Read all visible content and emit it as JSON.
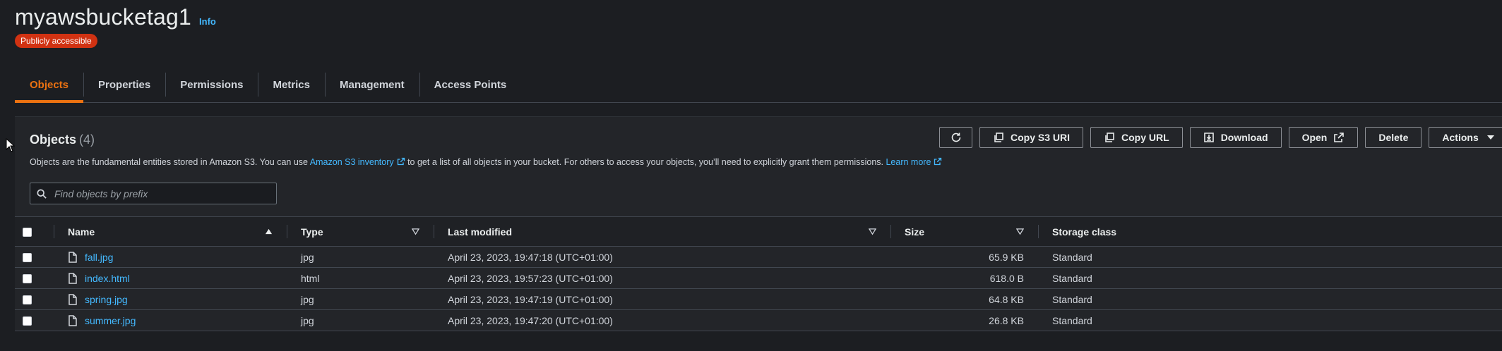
{
  "bucket": {
    "name": "myawsbucketag1",
    "info_label": "Info",
    "access_badge": "Publicly accessible"
  },
  "tabs": [
    {
      "label": "Objects",
      "active": true
    },
    {
      "label": "Properties"
    },
    {
      "label": "Permissions"
    },
    {
      "label": "Metrics"
    },
    {
      "label": "Management"
    },
    {
      "label": "Access Points"
    }
  ],
  "objects_panel": {
    "heading": "Objects",
    "count": "(4)",
    "desc_part1": "Objects are the fundamental entities stored in Amazon S3. You can use ",
    "inventory_link": "Amazon S3 inventory",
    "desc_part2": " to get a list of all objects in your bucket. For others to access your objects, you’ll need to explicitly grant them permissions. ",
    "learn_more": "Learn more",
    "search_placeholder": "Find objects by prefix"
  },
  "toolbar": {
    "copy_s3_uri": "Copy S3 URI",
    "copy_url": "Copy URL",
    "download": "Download",
    "open": "Open",
    "delete": "Delete",
    "actions": "Actions"
  },
  "table": {
    "headers": {
      "name": "Name",
      "type": "Type",
      "last_modified": "Last modified",
      "size": "Size",
      "storage_class": "Storage class"
    },
    "rows": [
      {
        "name": "fall.jpg",
        "type": "jpg",
        "last_modified": "April 23, 2023, 19:47:18 (UTC+01:00)",
        "size": "65.9 KB",
        "storage_class": "Standard"
      },
      {
        "name": "index.html",
        "type": "html",
        "last_modified": "April 23, 2023, 19:57:23 (UTC+01:00)",
        "size": "618.0 B",
        "storage_class": "Standard"
      },
      {
        "name": "spring.jpg",
        "type": "jpg",
        "last_modified": "April 23, 2023, 19:47:19 (UTC+01:00)",
        "size": "64.8 KB",
        "storage_class": "Standard"
      },
      {
        "name": "summer.jpg",
        "type": "jpg",
        "last_modified": "April 23, 2023, 19:47:20 (UTC+01:00)",
        "size": "26.8 KB",
        "storage_class": "Standard"
      }
    ]
  },
  "colors": {
    "accent_orange": "#ec7211",
    "link_blue": "#44b9ff",
    "badge_red": "#d13212"
  }
}
